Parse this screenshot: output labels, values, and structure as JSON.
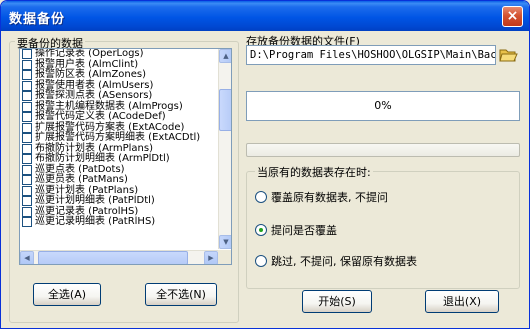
{
  "window": {
    "title": "数据备份",
    "close_glyph": "×"
  },
  "left_panel": {
    "label": "要备份的数据",
    "items": [
      "操作记录表 (OperLogs)",
      "报警用户表 (AlmClint)",
      "报警防区表 (AlmZones)",
      "报警使用者表 (AlmUsers)",
      "报警探测点表 (ASensors)",
      "报警主机编程数据表 (AlmProgs)",
      "报警代码定义表 (ACodeDef)",
      "扩展报警代码方案表 (ExtACode)",
      "扩展报警代码方案明细表 (ExtACDtl)",
      "布撤防计划表 (ArmPlans)",
      "布撤防计划明细表 (ArmPlDtl)",
      "巡更点表 (PatDots)",
      "巡更员表 (PatMans)",
      "巡更计划表 (PatPlans)",
      "巡更计划明细表 (PatPlDtl)",
      "巡更记录表 (PatrolHS)",
      "巡更记录明细表 (PatRlHS)"
    ],
    "select_all_label": "全选(A)",
    "select_none_label": "全不选(N)"
  },
  "right_panel": {
    "path_label": "存放备份数据的文件(F)",
    "path_value": "D:\\Program Files\\HOSHOO\\OLGSIP\\Main\\Backu",
    "progress_text": "0%",
    "progress_value": 0,
    "group_title": "当原有的数据表存在时:",
    "options": [
      {
        "label": "覆盖原有数据表, 不提问",
        "checked": false
      },
      {
        "label": "提问是否覆盖",
        "checked": true
      },
      {
        "label": "跳过, 不提问, 保留原有数据表",
        "checked": false
      }
    ],
    "start_label": "开始(S)",
    "exit_label": "退出(X)"
  },
  "colors": {
    "titlebar": "#0055e5",
    "progress_fill": "#2b58d0",
    "window_bg": "#ece9d8"
  }
}
